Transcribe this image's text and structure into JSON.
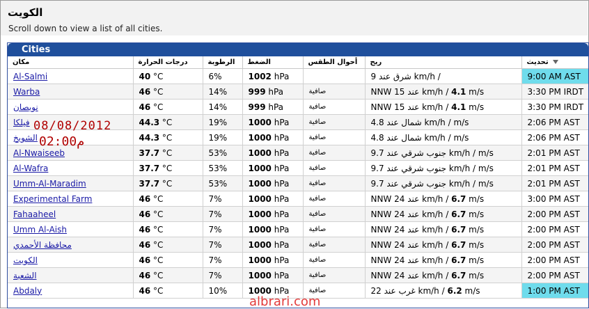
{
  "page": {
    "title": "الكويت",
    "subtitle": "Scroll down to view a list of all cities."
  },
  "panel": {
    "title": "Cities"
  },
  "columns": {
    "place": "مكان",
    "temp": "درجات الحرارة",
    "humidity": "الرطوبة",
    "pressure": "الضغط",
    "conditions": "أحوال الطقس",
    "wind": "ريح",
    "updated": "تحديث"
  },
  "rows": [
    {
      "city": "Al-Salmi",
      "temp": "40",
      "temp_unit": " °C",
      "hum": "6%",
      "pres": "1002",
      "pres_unit": " hPa",
      "cond": "",
      "wind_dir": "9 شرق عند",
      "wind_speed": " km/h /",
      "wind_ms": "",
      "wind_ms_unit": "",
      "updated": "9:00 AM AST",
      "hl": true
    },
    {
      "city": "Warba",
      "temp": "46",
      "temp_unit": " °C",
      "hum": "14%",
      "pres": "999",
      "pres_unit": " hPa",
      "cond": "صافية",
      "wind_dir": "NNW 15 عند",
      "wind_speed": " km/h / ",
      "wind_ms": "4.1",
      "wind_ms_unit": " m/s",
      "updated": "3:30 PM IRDT",
      "hl": false
    },
    {
      "city": "نويصان",
      "temp": "46",
      "temp_unit": " °C",
      "hum": "14%",
      "pres": "999",
      "pres_unit": " hPa",
      "cond": "صافية",
      "wind_dir": "NNW 15 عند",
      "wind_speed": " km/h / ",
      "wind_ms": "4.1",
      "wind_ms_unit": " m/s",
      "updated": "3:30 PM IRDT",
      "hl": false
    },
    {
      "city": "فيلكا",
      "temp": "44.3",
      "temp_unit": " °C",
      "hum": "19%",
      "pres": "1000",
      "pres_unit": " hPa",
      "cond": "صافية",
      "wind_dir": "4.8 شمال عند",
      "wind_speed": " km/h /  m/s",
      "wind_ms": "",
      "wind_ms_unit": "",
      "updated": "2:06 PM AST",
      "hl": false
    },
    {
      "city": "الشويخ",
      "temp": "44.3",
      "temp_unit": " °C",
      "hum": "19%",
      "pres": "1000",
      "pres_unit": " hPa",
      "cond": "صافية",
      "wind_dir": "4.8 شمال عند",
      "wind_speed": " km/h /  m/s",
      "wind_ms": "",
      "wind_ms_unit": "",
      "updated": "2:06 PM AST",
      "hl": false
    },
    {
      "city": "Al-Nwaiseeb",
      "temp": "37.7",
      "temp_unit": " °C",
      "hum": "53%",
      "pres": "1000",
      "pres_unit": " hPa",
      "cond": "صافية",
      "wind_dir": "9.7 جنوب شرقي عند",
      "wind_speed": " km/h /  m/s",
      "wind_ms": "",
      "wind_ms_unit": "",
      "updated": "2:01 PM AST",
      "hl": false
    },
    {
      "city": "Al-Wafra",
      "temp": "37.7",
      "temp_unit": " °C",
      "hum": "53%",
      "pres": "1000",
      "pres_unit": " hPa",
      "cond": "صافية",
      "wind_dir": "9.7 جنوب شرقي عند",
      "wind_speed": " km/h /  m/s",
      "wind_ms": "",
      "wind_ms_unit": "",
      "updated": "2:01 PM AST",
      "hl": false
    },
    {
      "city": "Umm-Al-Maradim",
      "temp": "37.7",
      "temp_unit": " °C",
      "hum": "53%",
      "pres": "1000",
      "pres_unit": " hPa",
      "cond": "صافية",
      "wind_dir": "9.7 جنوب شرقي عند",
      "wind_speed": " km/h /  m/s",
      "wind_ms": "",
      "wind_ms_unit": "",
      "updated": "2:01 PM AST",
      "hl": false
    },
    {
      "city": "Experimental Farm",
      "temp": "46",
      "temp_unit": " °C",
      "hum": "7%",
      "pres": "1000",
      "pres_unit": " hPa",
      "cond": "صافية",
      "wind_dir": "NNW 24 عند",
      "wind_speed": " km/h / ",
      "wind_ms": "6.7",
      "wind_ms_unit": " m/s",
      "updated": "3:00 PM AST",
      "hl": false
    },
    {
      "city": "Fahaaheel",
      "temp": "46",
      "temp_unit": " °C",
      "hum": "7%",
      "pres": "1000",
      "pres_unit": " hPa",
      "cond": "صافية",
      "wind_dir": "NNW 24 عند",
      "wind_speed": " km/h / ",
      "wind_ms": "6.7",
      "wind_ms_unit": " m/s",
      "updated": "2:00 PM AST",
      "hl": false
    },
    {
      "city": "Umm Al-Aish",
      "temp": "46",
      "temp_unit": " °C",
      "hum": "7%",
      "pres": "1000",
      "pres_unit": " hPa",
      "cond": "صافية",
      "wind_dir": "NNW 24 عند",
      "wind_speed": " km/h / ",
      "wind_ms": "6.7",
      "wind_ms_unit": " m/s",
      "updated": "2:00 PM AST",
      "hl": false
    },
    {
      "city": "محافظة الأحمدي",
      "temp": "46",
      "temp_unit": " °C",
      "hum": "7%",
      "pres": "1000",
      "pres_unit": " hPa",
      "cond": "صافية",
      "wind_dir": "NNW 24 عند",
      "wind_speed": " km/h / ",
      "wind_ms": "6.7",
      "wind_ms_unit": " m/s",
      "updated": "2:00 PM AST",
      "hl": false
    },
    {
      "city": "الكويت",
      "temp": "46",
      "temp_unit": " °C",
      "hum": "7%",
      "pres": "1000",
      "pres_unit": " hPa",
      "cond": "صافية",
      "wind_dir": "NNW 24 عند",
      "wind_speed": " km/h / ",
      "wind_ms": "6.7",
      "wind_ms_unit": " m/s",
      "updated": "2:00 PM AST",
      "hl": false
    },
    {
      "city": "الشعبة",
      "temp": "46",
      "temp_unit": " °C",
      "hum": "7%",
      "pres": "1000",
      "pres_unit": " hPa",
      "cond": "صافية",
      "wind_dir": "NNW 24 عند",
      "wind_speed": " km/h / ",
      "wind_ms": "6.7",
      "wind_ms_unit": " m/s",
      "updated": "2:00 PM AST",
      "hl": false
    },
    {
      "city": "Abdaly",
      "temp": "46",
      "temp_unit": " °C",
      "hum": "10%",
      "pres": "1000",
      "pres_unit": " hPa",
      "cond": "صافية",
      "wind_dir": "22 غرب عند",
      "wind_speed": " km/h / ",
      "wind_ms": "6.2",
      "wind_ms_unit": " m/s",
      "updated": "1:00 PM AST",
      "hl": true
    }
  ],
  "overlay": {
    "date": "08/08/2012",
    "time": "02:00م"
  },
  "watermark": "albrari.com",
  "colors": {
    "header_bar": "#1f4f9c",
    "highlight": "#6fdcec",
    "overlay_text": "#b00000",
    "link": "#1a1aa6"
  }
}
